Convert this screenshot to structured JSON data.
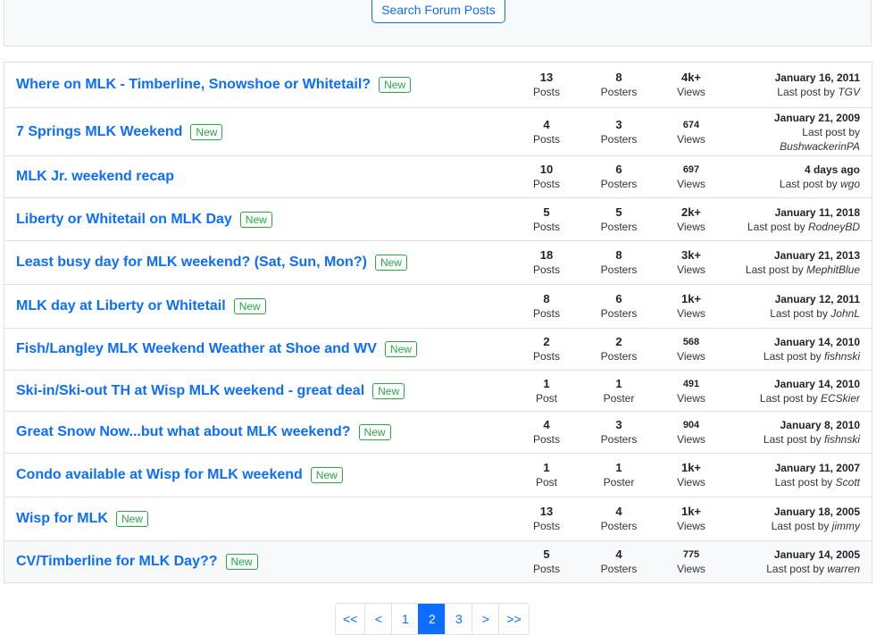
{
  "search": {
    "button_label": "Search Forum Posts"
  },
  "threads": [
    {
      "title": "Where on MLK - Timberline, Snowshoe or Whitetail?",
      "new": true,
      "posts": "13",
      "posts_label": "Posts",
      "posters": "8",
      "posters_label": "Posters",
      "views": "4k+",
      "views_label": "Views",
      "date": "January 16, 2011",
      "last_prefix": "Last post by",
      "last_user": "TGV"
    },
    {
      "title": "7 Springs MLK Weekend",
      "new": true,
      "posts": "4",
      "posts_label": "Posts",
      "posters": "3",
      "posters_label": "Posters",
      "views": "674",
      "views_label": "Views",
      "date": "January 21, 2009",
      "last_prefix": "Last post by",
      "last_user": "BushwackerinPA"
    },
    {
      "title": "MLK Jr. weekend recap",
      "new": false,
      "posts": "10",
      "posts_label": "Posts",
      "posters": "6",
      "posters_label": "Posters",
      "views": "697",
      "views_label": "Views",
      "date": "4 days ago",
      "last_prefix": "Last post by",
      "last_user": "wgo"
    },
    {
      "title": "Liberty or Whitetail on MLK Day",
      "new": true,
      "posts": "5",
      "posts_label": "Posts",
      "posters": "5",
      "posters_label": "Posters",
      "views": "2k+",
      "views_label": "Views",
      "date": "January 11, 2018",
      "last_prefix": "Last post by",
      "last_user": "RodneyBD"
    },
    {
      "title": "Least busy day for MLK weekend? (Sat, Sun, Mon?)",
      "new": true,
      "posts": "18",
      "posts_label": "Posts",
      "posters": "8",
      "posters_label": "Posters",
      "views": "3k+",
      "views_label": "Views",
      "date": "January 21, 2013",
      "last_prefix": "Last post by",
      "last_user": "MephitBlue"
    },
    {
      "title": "MLK day at Liberty or Whitetail",
      "new": true,
      "posts": "8",
      "posts_label": "Posts",
      "posters": "6",
      "posters_label": "Posters",
      "views": "1k+",
      "views_label": "Views",
      "date": "January 12, 2011",
      "last_prefix": "Last post by",
      "last_user": "JohnL"
    },
    {
      "title": "Fish/Langley MLK Weekend Weather at Shoe and WV",
      "new": true,
      "posts": "2",
      "posts_label": "Posts",
      "posters": "2",
      "posters_label": "Posters",
      "views": "568",
      "views_label": "Views",
      "date": "January 14, 2010",
      "last_prefix": "Last post by",
      "last_user": "fishnski"
    },
    {
      "title": "Ski-in/Ski-out TH at Wisp MLK weekend - great deal",
      "new": true,
      "posts": "1",
      "posts_label": "Post",
      "posters": "1",
      "posters_label": "Poster",
      "views": "491",
      "views_label": "Views",
      "date": "January 14, 2010",
      "last_prefix": "Last post by",
      "last_user": "ECSkier"
    },
    {
      "title": "Great Snow Now...but what about MLK weekend?",
      "new": true,
      "posts": "4",
      "posts_label": "Posts",
      "posters": "3",
      "posters_label": "Posters",
      "views": "904",
      "views_label": "Views",
      "date": "January 8, 2010",
      "last_prefix": "Last post by",
      "last_user": "fishnski"
    },
    {
      "title": "Condo available at Wisp for MLK weekend",
      "new": true,
      "posts": "1",
      "posts_label": "Post",
      "posters": "1",
      "posters_label": "Poster",
      "views": "1k+",
      "views_label": "Views",
      "date": "January 11, 2007",
      "last_prefix": "Last post by",
      "last_user": "Scott"
    },
    {
      "title": "Wisp for MLK",
      "new": true,
      "posts": "13",
      "posts_label": "Posts",
      "posters": "4",
      "posters_label": "Posters",
      "views": "1k+",
      "views_label": "Views",
      "date": "January 18, 2005",
      "last_prefix": "Last post by",
      "last_user": "jimmy"
    },
    {
      "title": "CV/Timberline for MLK Day??",
      "new": true,
      "posts": "5",
      "posts_label": "Posts",
      "posters": "4",
      "posters_label": "Posters",
      "views": "775",
      "views_label": "Views",
      "date": "January 14, 2005",
      "last_prefix": "Last post by",
      "last_user": "warren"
    }
  ],
  "new_badge_label": "New",
  "pagination": {
    "items": [
      "<<",
      "<",
      "1",
      "2",
      "3",
      ">",
      ">>"
    ],
    "active": "2"
  }
}
